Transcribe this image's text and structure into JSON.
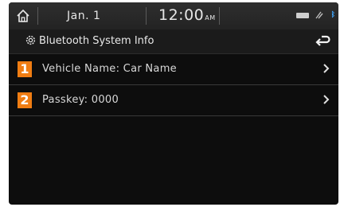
{
  "statusbar": {
    "date": "Jan.  1",
    "time": "12:00",
    "ampm": "AM"
  },
  "titlebar": {
    "title": "Bluetooth System Info"
  },
  "items": [
    {
      "number": "1",
      "label": "Vehicle Name: Car Name"
    },
    {
      "number": "2",
      "label": "Passkey: 0000"
    }
  ],
  "colors": {
    "accent": "#f07d13",
    "background": "#0d0d0d",
    "bluetooth": "#3fa7ff"
  }
}
